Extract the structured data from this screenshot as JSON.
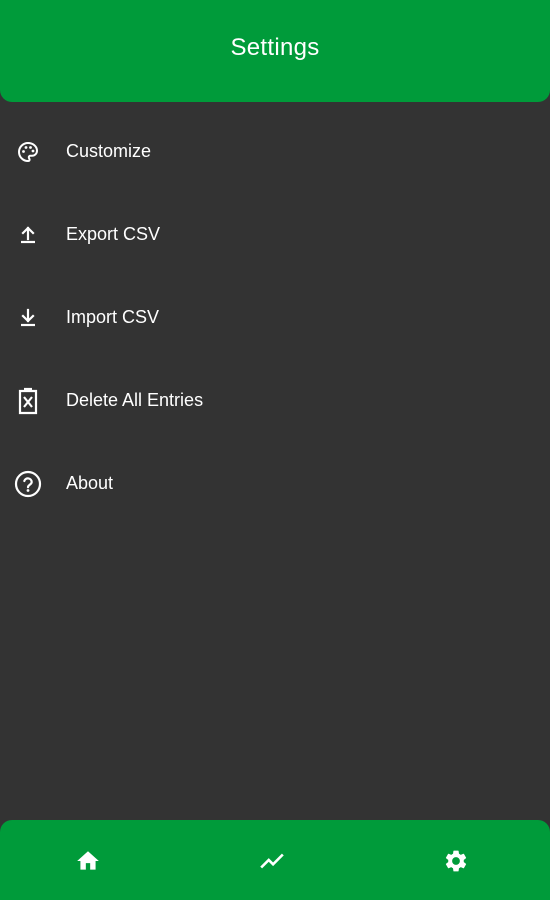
{
  "app_bar": {
    "title": "Settings",
    "color": "#009b3a"
  },
  "menu": {
    "items": [
      {
        "label": "Customize",
        "icon": "palette-icon"
      },
      {
        "label": "Export CSV",
        "icon": "upload-icon"
      },
      {
        "label": "Import CSV",
        "icon": "download-icon"
      },
      {
        "label": "Delete All Entries",
        "icon": "delete-document-icon"
      },
      {
        "label": "About",
        "icon": "help-circle-icon"
      }
    ]
  },
  "bottom_nav": {
    "items": [
      {
        "icon": "home-icon"
      },
      {
        "icon": "trending-up-icon"
      },
      {
        "icon": "gear-icon"
      }
    ],
    "color": "#009b3a"
  },
  "background_color": "#333333"
}
